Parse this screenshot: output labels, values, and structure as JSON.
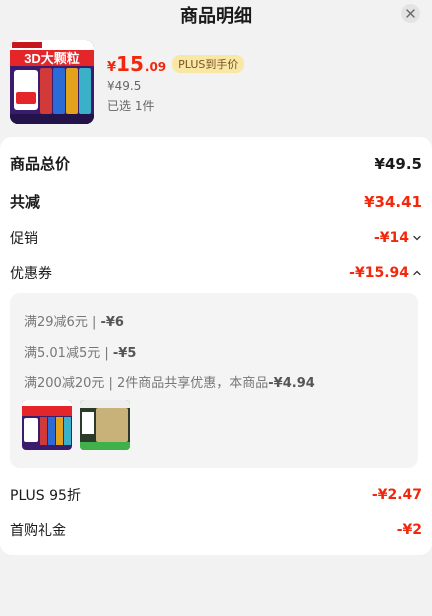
{
  "header": {
    "title": "商品明细"
  },
  "product": {
    "image_text": "3D大颗粒",
    "price_currency": "¥",
    "price_int": "15",
    "price_dec": ".09",
    "plus_tag": "PLUS到手价",
    "original_price": "¥49.5",
    "selected": "已选 1件"
  },
  "summary": {
    "total_label": "商品总价",
    "total_value": "¥49.5",
    "reduce_label": "共减",
    "reduce_value": "¥34.41",
    "promo_label": "促销",
    "promo_value": "-¥14",
    "coupon_label": "优惠券",
    "coupon_value": "-¥15.94"
  },
  "coupons": [
    {
      "text": "满29减6元 | ",
      "amount": "-¥6"
    },
    {
      "text": "满5.01减5元 | ",
      "amount": "-¥5"
    },
    {
      "text": "满200减20元 | 2件商品共享优惠，本商品",
      "amount": "-¥4.94"
    }
  ],
  "extra": {
    "plus_label": "PLUS 95折",
    "plus_value": "-¥2.47",
    "first_label": "首购礼金",
    "first_value": "-¥2"
  },
  "colors": {
    "accent": "#f2270c",
    "plus_bg": "#f9e7a6"
  }
}
